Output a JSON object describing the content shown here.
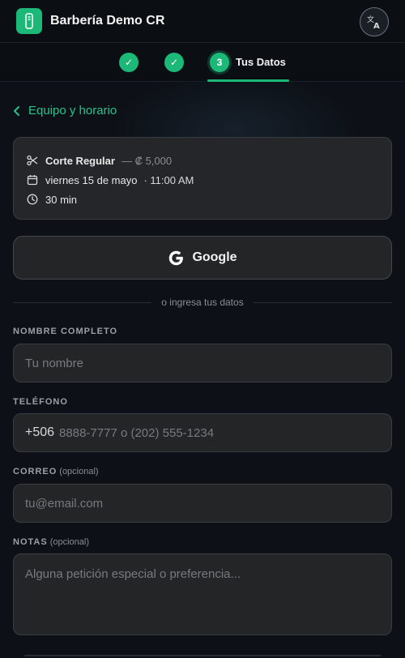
{
  "header": {
    "title": "Barbería Demo CR",
    "logo_icon": "clipper-icon",
    "translate_icon": "translate-icon"
  },
  "steps": {
    "step1_mark": "✓",
    "step2_mark": "✓",
    "step3_number": "3",
    "step3_label": "Tus Datos"
  },
  "back_link": {
    "label": "Equipo y horario"
  },
  "summary": {
    "service": "Corte Regular",
    "price": "— ₡ 5,000",
    "date": "viernes 15 de mayo",
    "time": "· 11:00 AM",
    "duration": "30 min"
  },
  "google_button": {
    "label": "Google"
  },
  "divider": {
    "text": "o ingresa tus datos"
  },
  "form": {
    "name": {
      "label": "NOMBRE COMPLETO",
      "placeholder": "Tu nombre",
      "value": ""
    },
    "phone": {
      "label": "TELÉFONO",
      "prefix": "+506",
      "placeholder": "8888-7777 o (202) 555-1234",
      "value": ""
    },
    "email": {
      "label": "CORREO",
      "optional": "(opcional)",
      "placeholder": "tu@email.com",
      "value": ""
    },
    "notes": {
      "label": "NOTAS",
      "optional": "(opcional)",
      "placeholder": "Alguna petición especial o preferencia...",
      "value": ""
    }
  },
  "colors": {
    "accent": "#1bb877",
    "link": "#22c58a",
    "background": "#0d1117",
    "card": "#242527"
  }
}
